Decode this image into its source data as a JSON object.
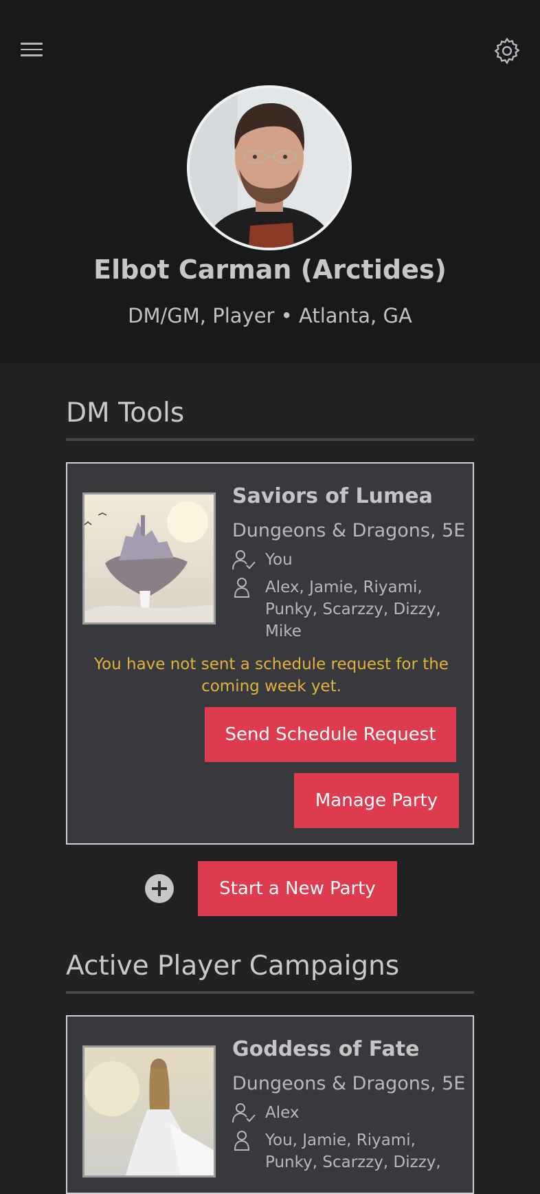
{
  "header": {
    "menu_icon": "hamburger-menu-icon",
    "settings_icon": "gear-icon",
    "profile_name": "Elbot Carman (Arctides)",
    "profile_subtitle": "DM/GM, Player • Atlanta, GA"
  },
  "dm_tools": {
    "section_title": "DM Tools",
    "card": {
      "title": "Saviors of Lumea",
      "system": "Dungeons & Dragons, 5E",
      "dm_label": "You",
      "players": "Alex, Jamie, Riyami, Punky, Scarzzy, Dizzy, Mike",
      "notice": "You have not sent a schedule request for the coming week yet.",
      "send_schedule_label": "Send Schedule Request",
      "manage_party_label": "Manage Party"
    },
    "start_party_label": "Start a New Party"
  },
  "player_campaigns": {
    "section_title": "Active Player Campaigns",
    "card": {
      "title": "Goddess of Fate",
      "system": "Dungeons & Dragons, 5E",
      "dm_label": "Alex",
      "players": "You, Jamie, Riyami, Punky, Scarzzy, Dizzy,"
    }
  },
  "colors": {
    "accent": "#df3b4e",
    "notice": "#e2b23e",
    "header_bg": "#18191b",
    "body_bg": "#212224",
    "card_bg": "#38393c"
  }
}
